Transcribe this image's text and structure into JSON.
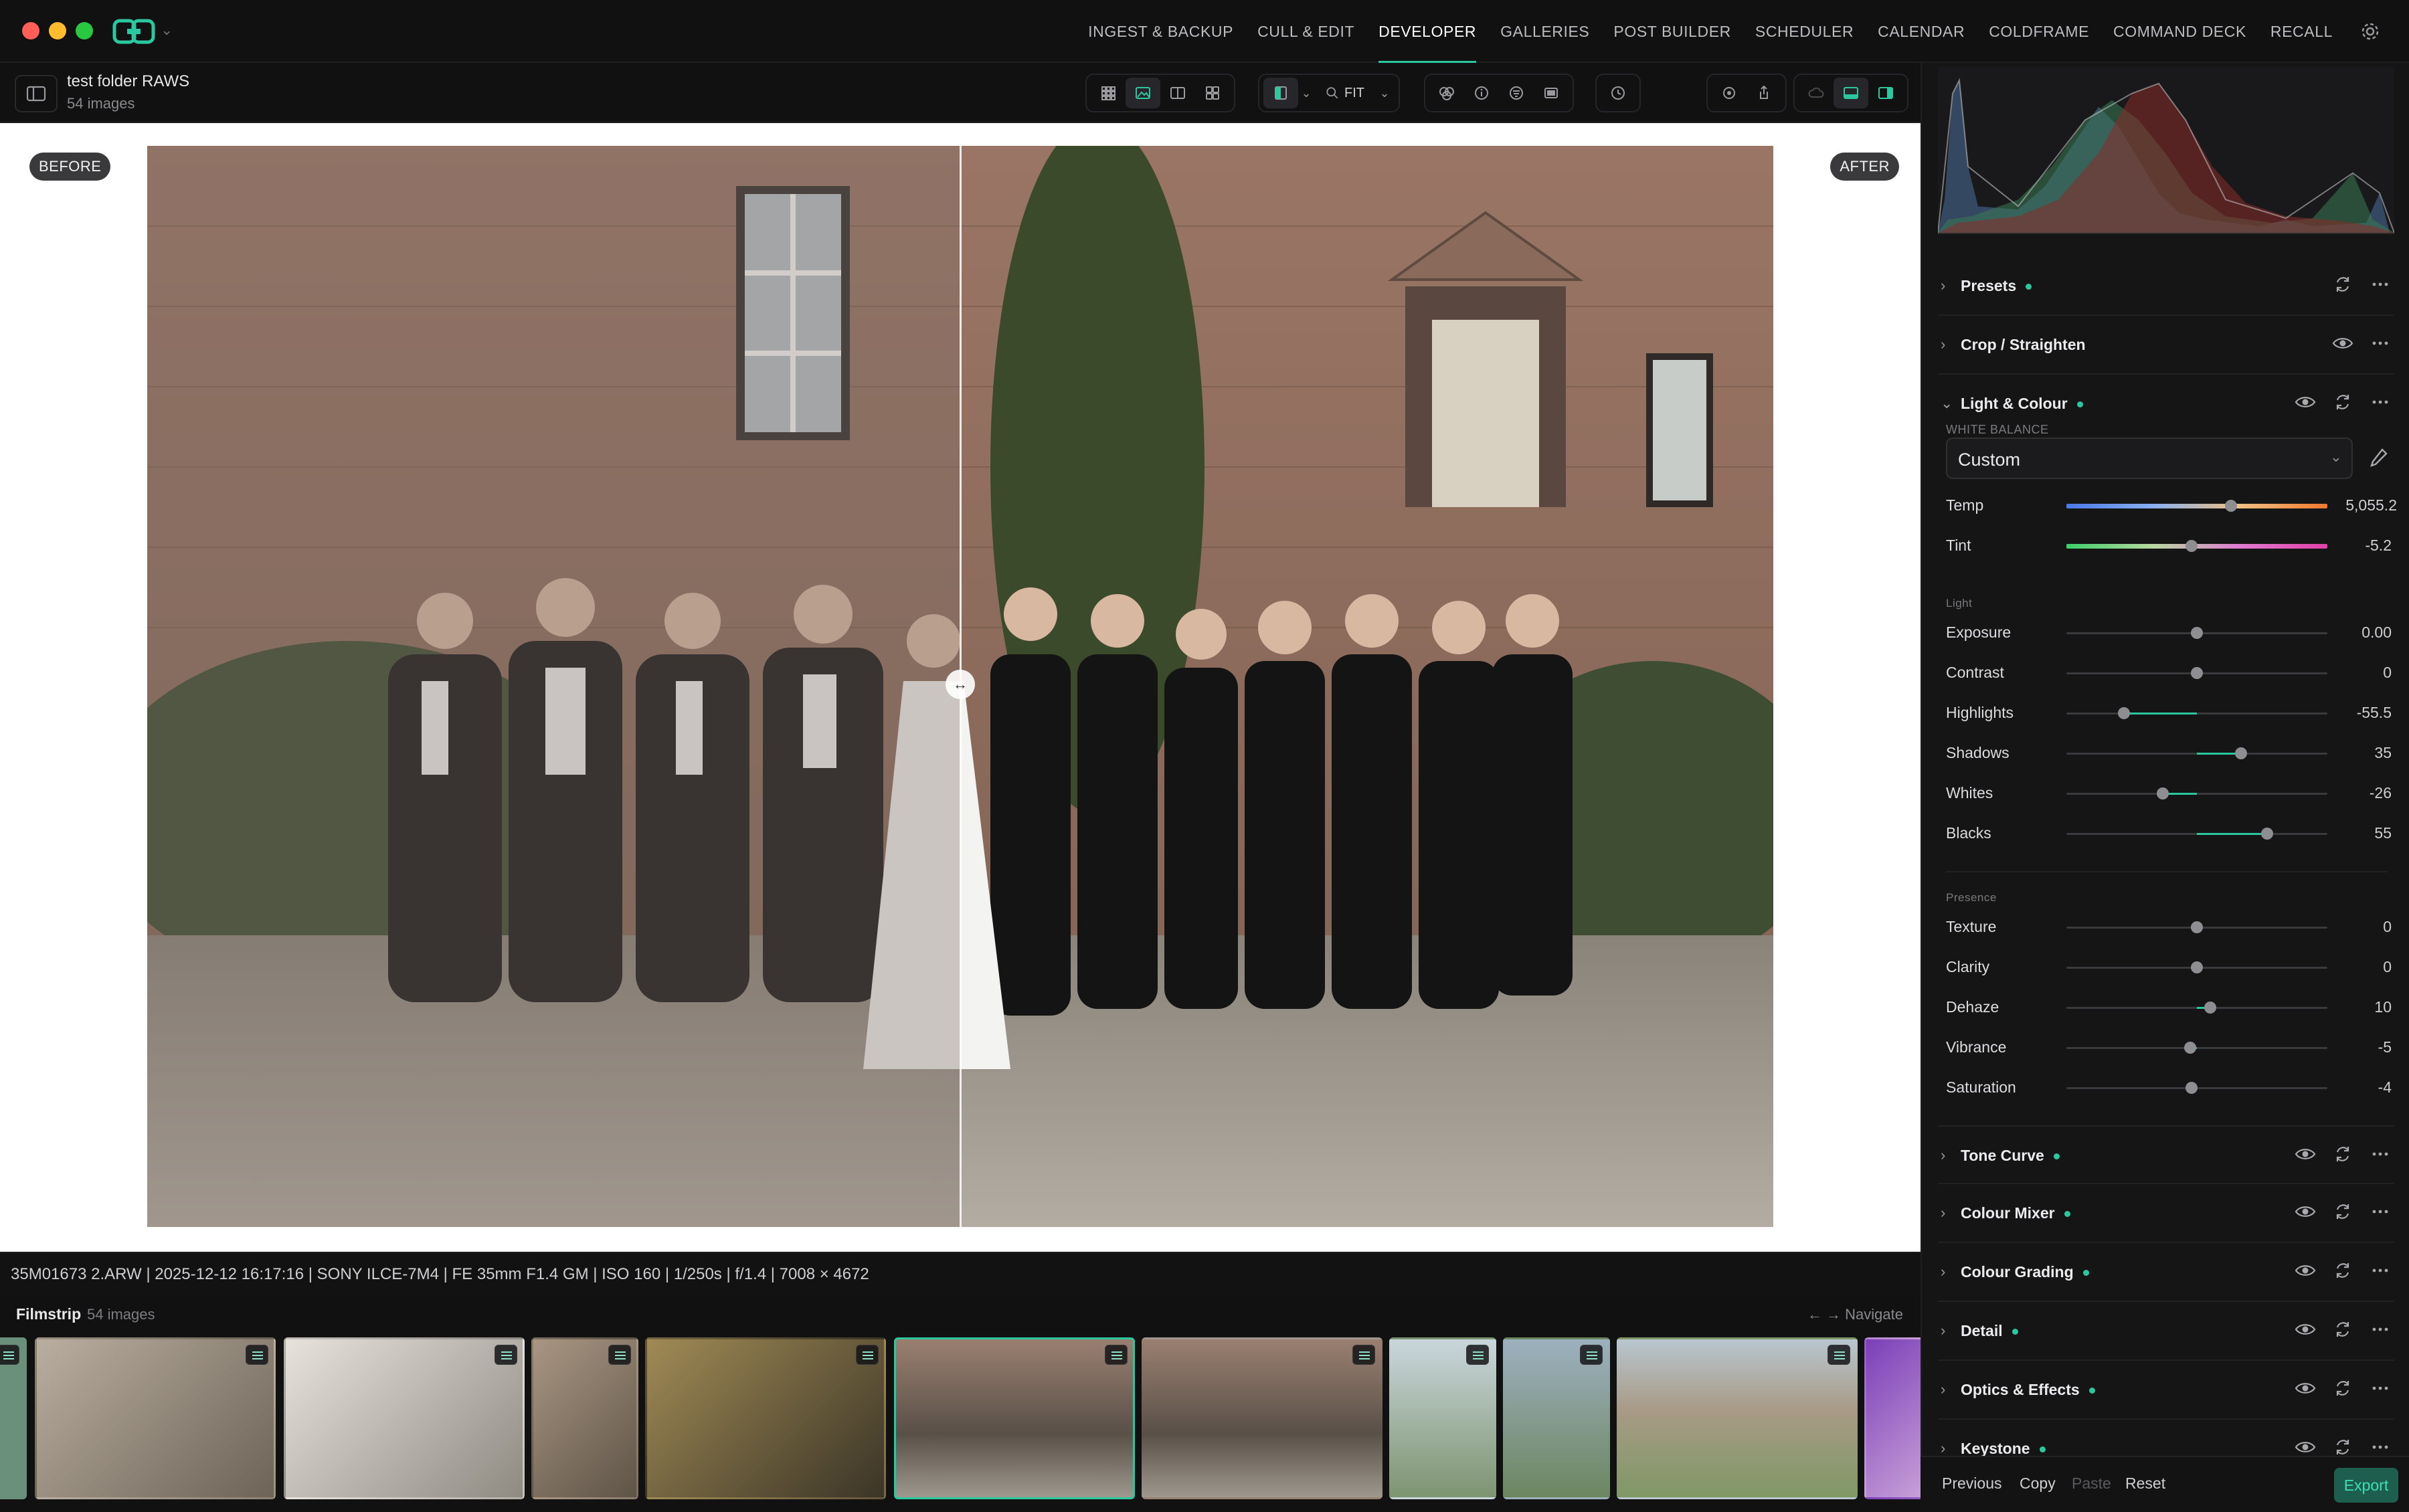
{
  "nav": {
    "items": [
      "INGEST & BACKUP",
      "CULL & EDIT",
      "DEVELOPER",
      "GALLERIES",
      "POST BUILDER",
      "SCHEDULER",
      "CALENDAR",
      "COLDFRAME",
      "COMMAND DECK",
      "RECALL"
    ],
    "active": "DEVELOPER"
  },
  "folder": {
    "name": "test folder RAWS",
    "count": "54 images"
  },
  "toolbar": {
    "zoom_label": "FIT"
  },
  "viewer": {
    "before_label": "BEFORE",
    "after_label": "AFTER"
  },
  "meta_text": "35M01673 2.ARW | 2025-12-12 16:17:16 | SONY ILCE-7M4 | FE 35mm F1.4 GM | ISO 160 | 1/250s | f/1.4 | 7008 × 4672",
  "filmstrip": {
    "title": "Filmstrip",
    "count": "54 images",
    "navigate_hint": "← → Navigate"
  },
  "panel": {
    "presets": "Presets",
    "crop": "Crop / Straighten",
    "light_colour": "Light & Colour",
    "white_balance_label": "WHITE BALANCE",
    "wb_value": "Custom",
    "light_label": "Light",
    "presence_label": "Presence",
    "tone_curve": "Tone Curve",
    "colour_mixer": "Colour Mixer",
    "colour_grading": "Colour Grading",
    "detail": "Detail",
    "optics": "Optics & Effects",
    "keystone": "Keystone"
  },
  "sliders": {
    "temp": {
      "label": "Temp",
      "value": "5,055.2",
      "position": 0.63
    },
    "tint": {
      "label": "Tint",
      "value": "-5.2",
      "position": 0.48
    },
    "exposure": {
      "label": "Exposure",
      "value": "0.00",
      "position": 0.5
    },
    "contrast": {
      "label": "Contrast",
      "value": "0",
      "position": 0.5
    },
    "highlights": {
      "label": "Highlights",
      "value": "-55.5",
      "position": 0.22
    },
    "shadows": {
      "label": "Shadows",
      "value": "35",
      "position": 0.67
    },
    "whites": {
      "label": "Whites",
      "value": "-26",
      "position": 0.37
    },
    "blacks": {
      "label": "Blacks",
      "value": "55",
      "position": 0.77
    },
    "texture": {
      "label": "Texture",
      "value": "0",
      "position": 0.5
    },
    "clarity": {
      "label": "Clarity",
      "value": "0",
      "position": 0.5
    },
    "dehaze": {
      "label": "Dehaze",
      "value": "10",
      "position": 0.55
    },
    "vibrance": {
      "label": "Vibrance",
      "value": "-5",
      "position": 0.475
    },
    "saturation": {
      "label": "Saturation",
      "value": "-4",
      "position": 0.48
    }
  },
  "footer": {
    "previous": "Previous",
    "copy": "Copy",
    "paste": "Paste",
    "reset": "Reset",
    "export": "Export"
  },
  "colors": {
    "accent": "#2bc8a0",
    "panel_bg": "#151516",
    "viewer_bg": "#ffffff"
  }
}
